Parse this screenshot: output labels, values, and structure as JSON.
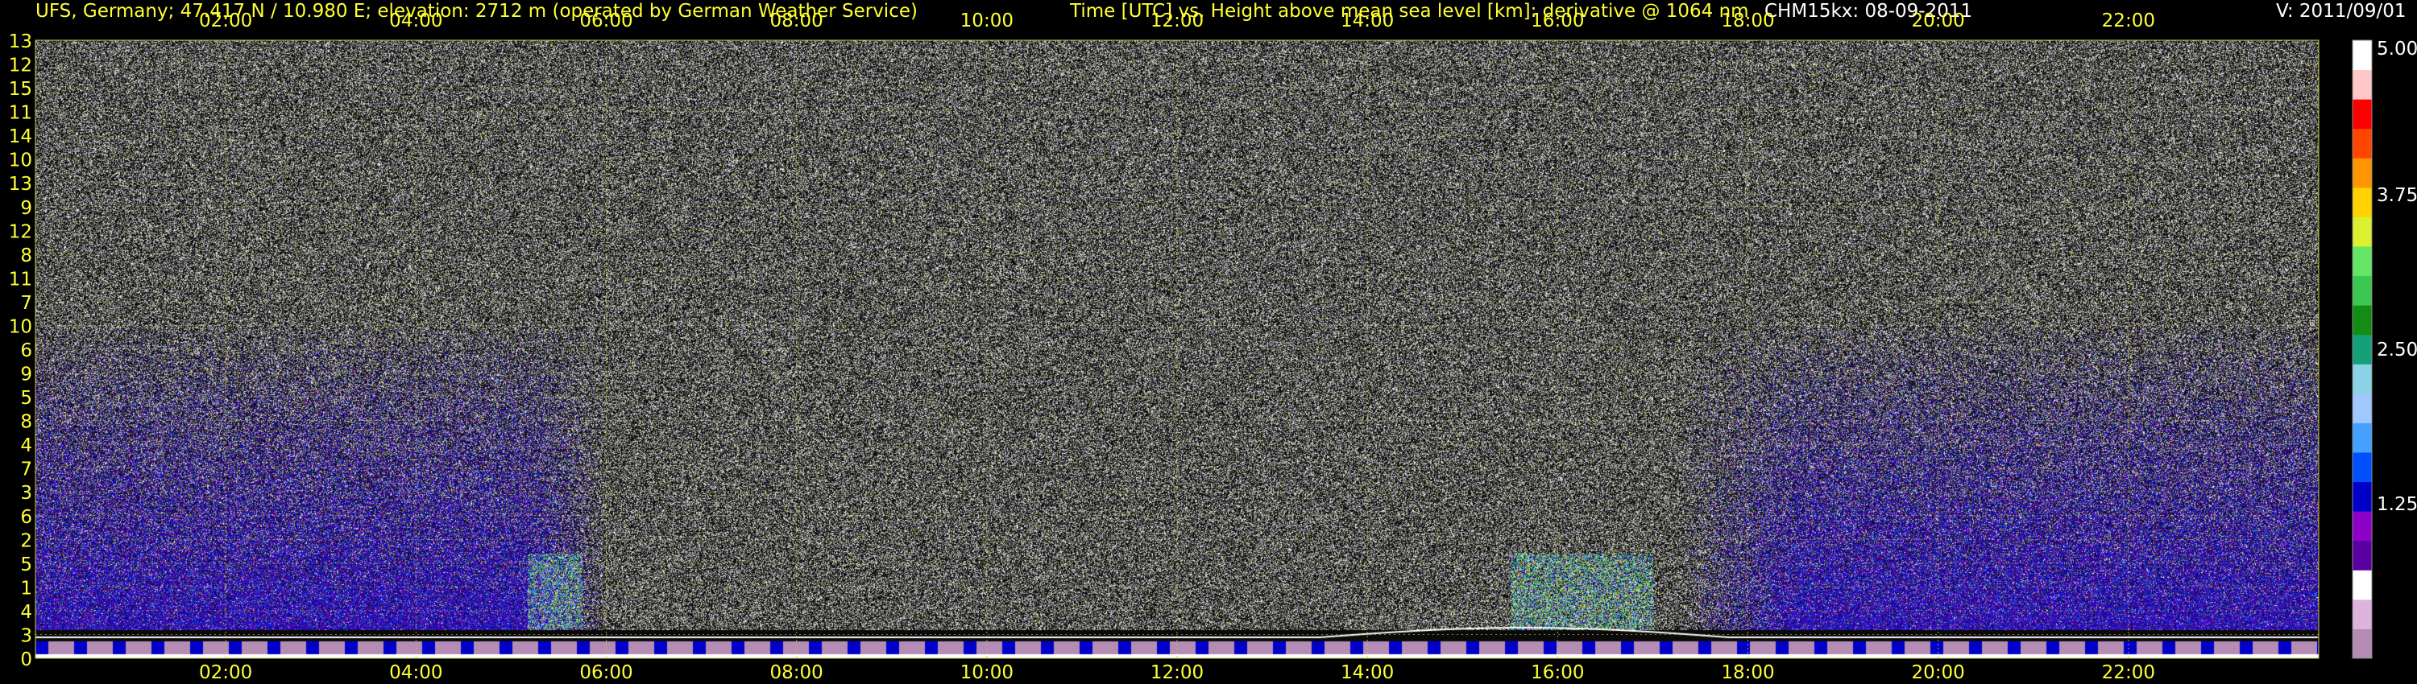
{
  "header": {
    "site": "UFS, Germany; 47.417 N / 10.980 E; elevation: 2712 m  (operated by German Weather Service)",
    "title": "Time [UTC] vs. Height above mean sea level [km]: derivative @ 1064 nm",
    "instrument": "CHM15kx: 08-09-2011",
    "version": "V: 2011/09/01"
  },
  "colors": {
    "background": "#000000",
    "text": "#ffff33",
    "grid": "#c8c84a",
    "colormap": [
      "#b48cb4",
      "#dcb4dc",
      "#ffffff",
      "#5a00a0",
      "#8c00c8",
      "#0000c8",
      "#0050ff",
      "#46a0ff",
      "#a0c8ff",
      "#8cd2e6",
      "#14a078",
      "#148c14",
      "#3cc850",
      "#64e664",
      "#dcf032",
      "#ffd200",
      "#ff9600",
      "#ff4600",
      "#ff0000",
      "#ffc8c8",
      "#ffffff"
    ]
  },
  "chart_data": {
    "type": "heatmap",
    "title": "Time [UTC] vs. Height above mean sea level [km]: derivative @ 1064 nm",
    "xlabel": "Time [UTC]",
    "ylabel": "Height above mean sea level [km]",
    "xlim": [
      "00:00",
      "24:00"
    ],
    "x_ticks": [
      "02:00",
      "04:00",
      "06:00",
      "08:00",
      "10:00",
      "12:00",
      "14:00",
      "16:00",
      "18:00",
      "20:00",
      "22:00"
    ],
    "y_ticks_left": [
      "0",
      "3",
      "4",
      "1",
      "5",
      "2",
      "6",
      "3",
      "7",
      "4",
      "8",
      "5",
      "9",
      "6",
      "10",
      "7",
      "11",
      "8",
      "12",
      "9",
      "13",
      "10",
      "14",
      "11",
      "15",
      "12",
      "13"
    ],
    "colorbar": {
      "min": 0,
      "max": 5.0,
      "ticks": [
        "1.25",
        "2.50",
        "3.75",
        "5.00"
      ]
    },
    "grid": true,
    "features": [
      {
        "name": "boundary layer top",
        "start": "00:00",
        "end": "24:00",
        "height_km": 3.0
      },
      {
        "name": "convective plume",
        "start": "05:10",
        "end": "05:45"
      },
      {
        "name": "convective plume",
        "start": "15:30",
        "end": "17:00"
      }
    ]
  }
}
